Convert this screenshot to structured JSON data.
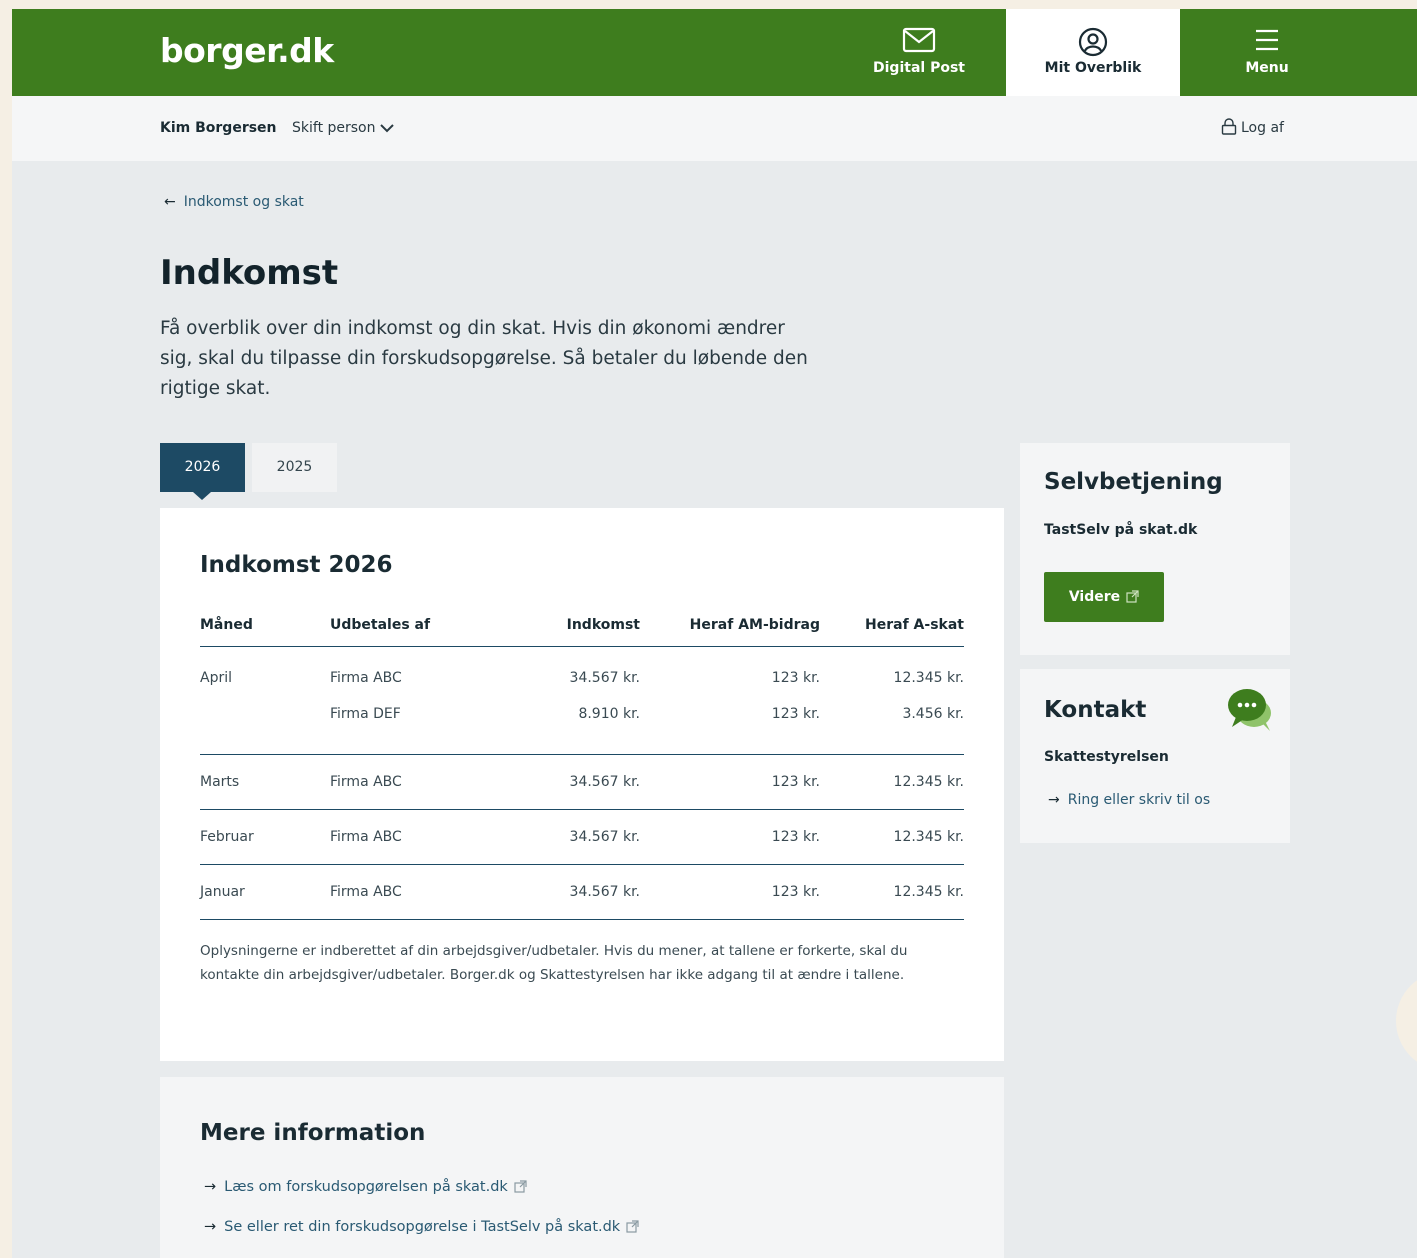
{
  "header": {
    "logo": "borger.dk",
    "nav": [
      {
        "label": "Digital Post",
        "icon": "mail-icon"
      },
      {
        "label": "Mit Overblik",
        "icon": "user-circle-icon"
      },
      {
        "label": "Menu",
        "icon": "hamburger-icon"
      }
    ]
  },
  "subbar": {
    "user_name": "Kim Borgersen",
    "switch_person": "Skift person",
    "logout": "Log af"
  },
  "breadcrumb": {
    "back_label": "Indkomst og skat"
  },
  "page": {
    "title": "Indkomst",
    "intro": "Få overblik over din indkomst og din skat. Hvis din økonomi ændrer sig, skal du tilpasse din forskudsopgørelse. Så betaler du løbende den rigtige skat."
  },
  "tabs": [
    {
      "label": "2026",
      "active": true
    },
    {
      "label": "2025",
      "active": false
    }
  ],
  "income": {
    "title": "Indkomst 2026",
    "columns": [
      "Måned",
      "Udbetales af",
      "Indkomst",
      "Heraf AM-bidrag",
      "Heraf A-skat"
    ],
    "rows": [
      {
        "month": "April",
        "payer": "Firma ABC",
        "income": "34.567 kr.",
        "am": "123 kr.",
        "askat": "12.345 kr."
      },
      {
        "month": "",
        "payer": "Firma DEF",
        "income": "8.910 kr.",
        "am": "123 kr.",
        "askat": "3.456 kr."
      },
      {
        "month": "Marts",
        "payer": "Firma ABC",
        "income": "34.567 kr.",
        "am": "123 kr.",
        "askat": "12.345 kr."
      },
      {
        "month": "Februar",
        "payer": "Firma ABC",
        "income": "34.567 kr.",
        "am": "123 kr.",
        "askat": "12.345 kr."
      },
      {
        "month": "Januar",
        "payer": "Firma ABC",
        "income": "34.567 kr.",
        "am": "123 kr.",
        "askat": "12.345 kr."
      }
    ],
    "note": "Oplysningerne er indberettet af din arbejdsgiver/udbetaler. Hvis du mener, at tallene er forkerte, skal du kontakte din arbejdsgiver/udbetaler. Borger.dk og Skattestyrelsen har ikke adgang til at ændre i tallene."
  },
  "more_info": {
    "title": "Mere information",
    "links": [
      "Læs om forskudsopgørelsen på skat.dk",
      "Se eller ret din forskudsopgørelse i TastSelv på skat.dk"
    ]
  },
  "self_service": {
    "title": "Selvbetjening",
    "subtitle": "TastSelv på skat.dk",
    "button": "Videre"
  },
  "contact": {
    "title": "Kontakt",
    "subtitle": "Skattestyrelsen",
    "link": "Ring eller skriv til os"
  },
  "colors": {
    "brand_green": "#3e7d1e",
    "navy": "#1d4a64",
    "link": "#2a5a73"
  }
}
